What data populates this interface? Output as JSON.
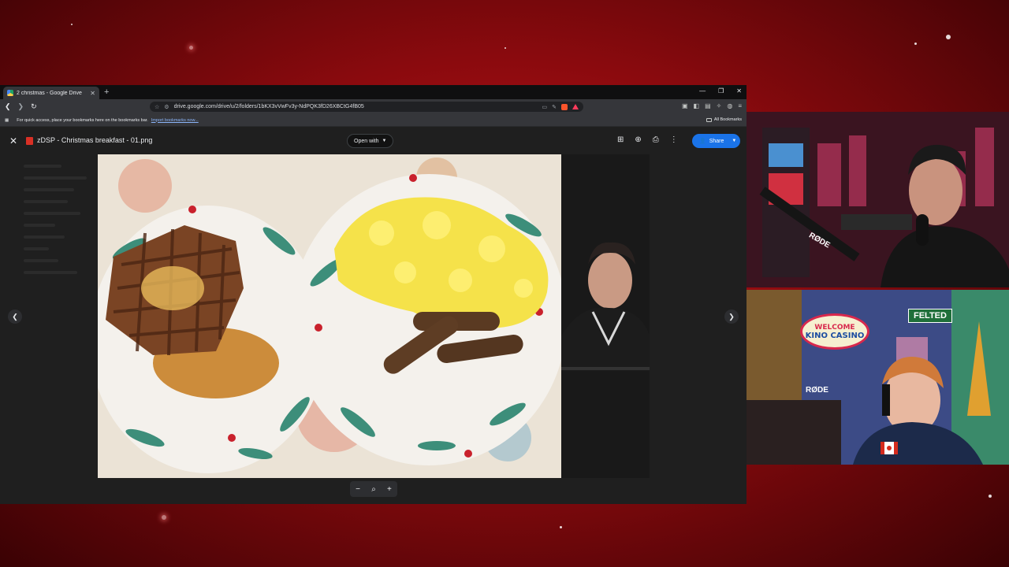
{
  "browser": {
    "tab_title": "2 christmas - Google Drive",
    "url": "drive.google.com/drive/u/2/folders/1bKX3vVwFv3y-NdPQK3fD26XBCtG4fB05",
    "bookmarks_prompt": "For quick access, place your bookmarks here on the bookmarks bar.",
    "import_link": "Import bookmarks now...",
    "all_bookmarks": "All Bookmarks"
  },
  "viewer": {
    "file_name": "zDSP - Christmas breakfast - 01.png",
    "open_with": "Open with",
    "share": "Share"
  },
  "overlay": {
    "sign_top": "WELCOME",
    "sign_bottom": "KINO CASINO",
    "street_sign": "FELTED",
    "mic_brand": "RØDE"
  },
  "icons": [
    "close-icon",
    "back-icon",
    "forward-icon",
    "reload-icon",
    "bookmark-star-icon",
    "apps-icon",
    "folder-icon",
    "add-to-drive-icon",
    "print-icon",
    "more-icon",
    "share-person-icon",
    "zoom-out-icon",
    "zoom-icon",
    "zoom-in-icon",
    "prev-arrow-icon",
    "next-arrow-icon"
  ]
}
